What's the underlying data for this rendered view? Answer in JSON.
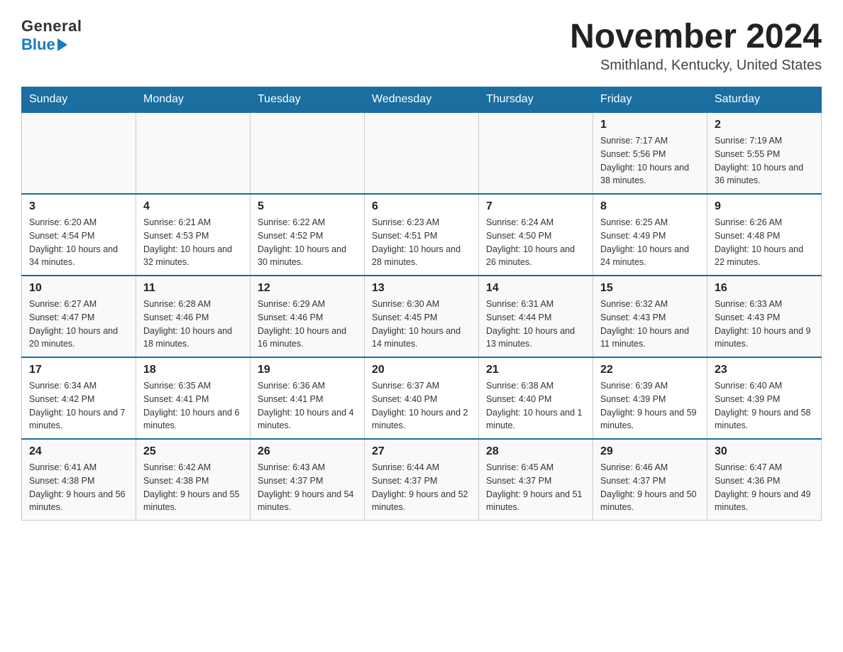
{
  "header": {
    "logo_general": "General",
    "logo_blue": "Blue",
    "month_title": "November 2024",
    "location": "Smithland, Kentucky, United States"
  },
  "weekdays": [
    "Sunday",
    "Monday",
    "Tuesday",
    "Wednesday",
    "Thursday",
    "Friday",
    "Saturday"
  ],
  "weeks": [
    [
      {
        "day": "",
        "info": ""
      },
      {
        "day": "",
        "info": ""
      },
      {
        "day": "",
        "info": ""
      },
      {
        "day": "",
        "info": ""
      },
      {
        "day": "",
        "info": ""
      },
      {
        "day": "1",
        "info": "Sunrise: 7:17 AM\nSunset: 5:56 PM\nDaylight: 10 hours and 38 minutes."
      },
      {
        "day": "2",
        "info": "Sunrise: 7:19 AM\nSunset: 5:55 PM\nDaylight: 10 hours and 36 minutes."
      }
    ],
    [
      {
        "day": "3",
        "info": "Sunrise: 6:20 AM\nSunset: 4:54 PM\nDaylight: 10 hours and 34 minutes."
      },
      {
        "day": "4",
        "info": "Sunrise: 6:21 AM\nSunset: 4:53 PM\nDaylight: 10 hours and 32 minutes."
      },
      {
        "day": "5",
        "info": "Sunrise: 6:22 AM\nSunset: 4:52 PM\nDaylight: 10 hours and 30 minutes."
      },
      {
        "day": "6",
        "info": "Sunrise: 6:23 AM\nSunset: 4:51 PM\nDaylight: 10 hours and 28 minutes."
      },
      {
        "day": "7",
        "info": "Sunrise: 6:24 AM\nSunset: 4:50 PM\nDaylight: 10 hours and 26 minutes."
      },
      {
        "day": "8",
        "info": "Sunrise: 6:25 AM\nSunset: 4:49 PM\nDaylight: 10 hours and 24 minutes."
      },
      {
        "day": "9",
        "info": "Sunrise: 6:26 AM\nSunset: 4:48 PM\nDaylight: 10 hours and 22 minutes."
      }
    ],
    [
      {
        "day": "10",
        "info": "Sunrise: 6:27 AM\nSunset: 4:47 PM\nDaylight: 10 hours and 20 minutes."
      },
      {
        "day": "11",
        "info": "Sunrise: 6:28 AM\nSunset: 4:46 PM\nDaylight: 10 hours and 18 minutes."
      },
      {
        "day": "12",
        "info": "Sunrise: 6:29 AM\nSunset: 4:46 PM\nDaylight: 10 hours and 16 minutes."
      },
      {
        "day": "13",
        "info": "Sunrise: 6:30 AM\nSunset: 4:45 PM\nDaylight: 10 hours and 14 minutes."
      },
      {
        "day": "14",
        "info": "Sunrise: 6:31 AM\nSunset: 4:44 PM\nDaylight: 10 hours and 13 minutes."
      },
      {
        "day": "15",
        "info": "Sunrise: 6:32 AM\nSunset: 4:43 PM\nDaylight: 10 hours and 11 minutes."
      },
      {
        "day": "16",
        "info": "Sunrise: 6:33 AM\nSunset: 4:43 PM\nDaylight: 10 hours and 9 minutes."
      }
    ],
    [
      {
        "day": "17",
        "info": "Sunrise: 6:34 AM\nSunset: 4:42 PM\nDaylight: 10 hours and 7 minutes."
      },
      {
        "day": "18",
        "info": "Sunrise: 6:35 AM\nSunset: 4:41 PM\nDaylight: 10 hours and 6 minutes."
      },
      {
        "day": "19",
        "info": "Sunrise: 6:36 AM\nSunset: 4:41 PM\nDaylight: 10 hours and 4 minutes."
      },
      {
        "day": "20",
        "info": "Sunrise: 6:37 AM\nSunset: 4:40 PM\nDaylight: 10 hours and 2 minutes."
      },
      {
        "day": "21",
        "info": "Sunrise: 6:38 AM\nSunset: 4:40 PM\nDaylight: 10 hours and 1 minute."
      },
      {
        "day": "22",
        "info": "Sunrise: 6:39 AM\nSunset: 4:39 PM\nDaylight: 9 hours and 59 minutes."
      },
      {
        "day": "23",
        "info": "Sunrise: 6:40 AM\nSunset: 4:39 PM\nDaylight: 9 hours and 58 minutes."
      }
    ],
    [
      {
        "day": "24",
        "info": "Sunrise: 6:41 AM\nSunset: 4:38 PM\nDaylight: 9 hours and 56 minutes."
      },
      {
        "day": "25",
        "info": "Sunrise: 6:42 AM\nSunset: 4:38 PM\nDaylight: 9 hours and 55 minutes."
      },
      {
        "day": "26",
        "info": "Sunrise: 6:43 AM\nSunset: 4:37 PM\nDaylight: 9 hours and 54 minutes."
      },
      {
        "day": "27",
        "info": "Sunrise: 6:44 AM\nSunset: 4:37 PM\nDaylight: 9 hours and 52 minutes."
      },
      {
        "day": "28",
        "info": "Sunrise: 6:45 AM\nSunset: 4:37 PM\nDaylight: 9 hours and 51 minutes."
      },
      {
        "day": "29",
        "info": "Sunrise: 6:46 AM\nSunset: 4:37 PM\nDaylight: 9 hours and 50 minutes."
      },
      {
        "day": "30",
        "info": "Sunrise: 6:47 AM\nSunset: 4:36 PM\nDaylight: 9 hours and 49 minutes."
      }
    ]
  ],
  "colors": {
    "header_bg": "#1a6ea0",
    "header_text": "#ffffff",
    "border": "#1a6ea0"
  }
}
